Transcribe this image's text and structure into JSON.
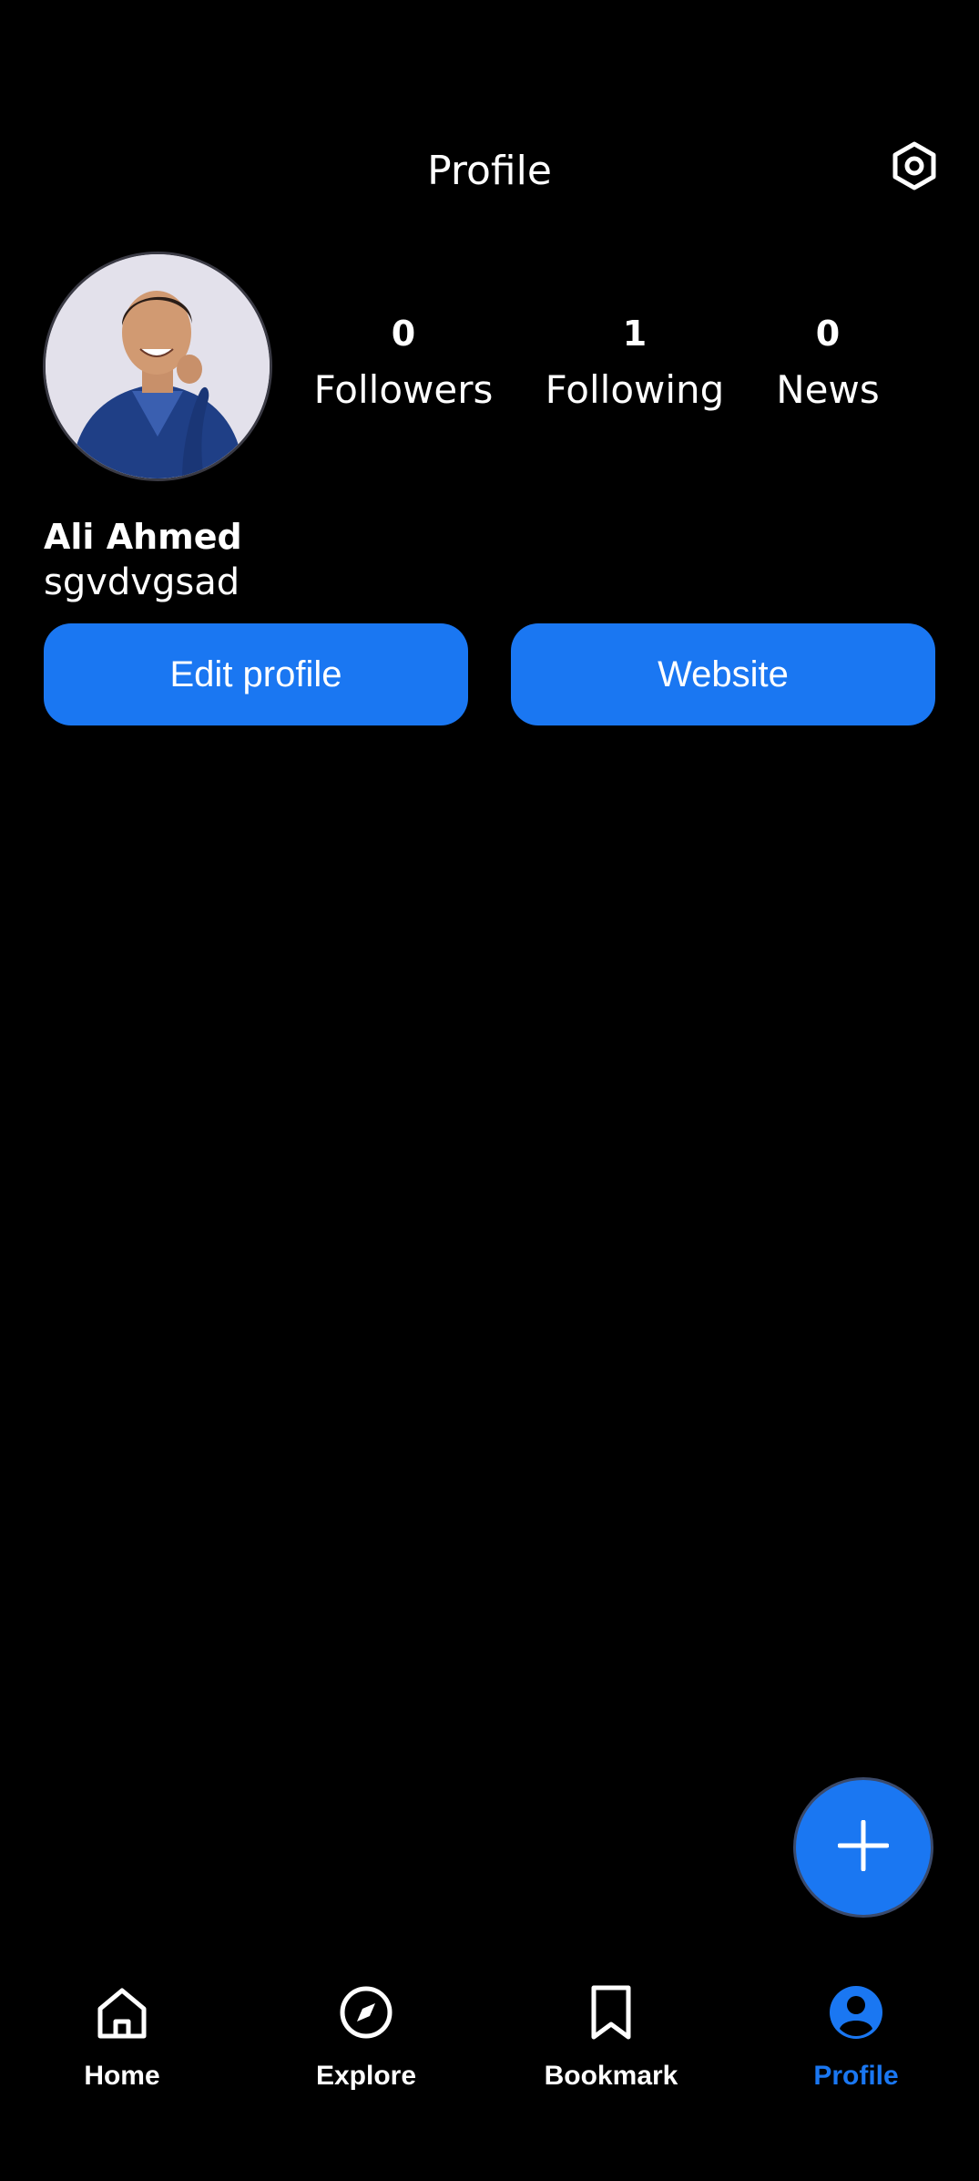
{
  "header": {
    "title": "Profile",
    "settings_icon": "settings-icon"
  },
  "profile": {
    "name": "Ali Ahmed",
    "handle": "sgvdvgsad",
    "stats": [
      {
        "value": "0",
        "label": "Followers"
      },
      {
        "value": "1",
        "label": "Following"
      },
      {
        "value": "0",
        "label": "News"
      }
    ]
  },
  "actions": {
    "edit_profile": "Edit profile",
    "website": "Website"
  },
  "fab": {
    "icon": "plus-icon"
  },
  "nav": {
    "items": [
      {
        "label": "Home",
        "icon": "home-icon"
      },
      {
        "label": "Explore",
        "icon": "compass-icon"
      },
      {
        "label": "Bookmark",
        "icon": "bookmark-icon"
      },
      {
        "label": "Profile",
        "icon": "user-circle-icon"
      }
    ],
    "active": "Profile"
  },
  "colors": {
    "background": "#000000",
    "accent": "#1a77f2",
    "text": "#ffffff"
  }
}
